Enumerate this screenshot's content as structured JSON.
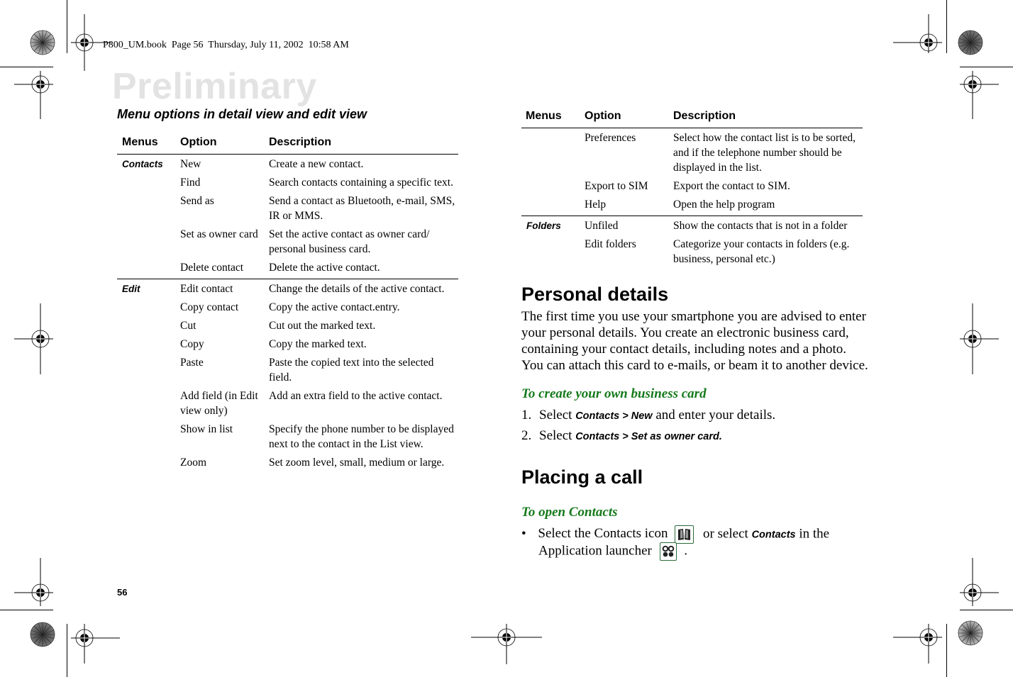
{
  "header": {
    "print_info": "P800_UM.book  Page 56  Thursday, July 11, 2002  10:58 AM",
    "watermark": "Preliminary"
  },
  "left_column": {
    "section_title": "Menu options in detail view and edit view",
    "table": {
      "columns": [
        "Menus",
        "Option",
        "Description"
      ],
      "groups": [
        {
          "menu": "Contacts",
          "rows": [
            {
              "option": "New",
              "description": "Create a new contact."
            },
            {
              "option": "Find",
              "description": "Search contacts containing a specific text."
            },
            {
              "option": "Send as",
              "description": "Send a contact as Bluetooth, e-mail, SMS, IR or MMS."
            },
            {
              "option": "Set as owner card",
              "description": "Set the active contact as owner card/ personal business card."
            },
            {
              "option": "Delete contact",
              "description": "Delete the active contact."
            }
          ]
        },
        {
          "menu": "Edit",
          "rows": [
            {
              "option": "Edit contact",
              "description": "Change the details of the active contact."
            },
            {
              "option": "Copy contact",
              "description": "Copy the active contact.entry."
            },
            {
              "option": "Cut",
              "description": "Cut out the marked text."
            },
            {
              "option": "Copy",
              "description": "Copy the marked text."
            },
            {
              "option": "Paste",
              "description": "Paste the copied text into the selected field."
            },
            {
              "option": "Add field (in Edit view only)",
              "description": "Add an extra field to the active contact."
            },
            {
              "option": "Show in list",
              "description": "Specify the phone number to be displayed next to the contact in the List view."
            },
            {
              "option": "Zoom",
              "description": "Set zoom level, small, medium or large."
            }
          ]
        }
      ]
    }
  },
  "right_column": {
    "table": {
      "columns": [
        "Menus",
        "Option",
        "Description"
      ],
      "groups": [
        {
          "menu": "",
          "rows": [
            {
              "option": "Preferences",
              "description": "Select how the contact list is to be sorted, and if the telephone number should be displayed in the list."
            },
            {
              "option": "Export to SIM",
              "description": "Export the contact to SIM."
            },
            {
              "option": "Help",
              "description": "Open the help program"
            }
          ]
        },
        {
          "menu": "Folders",
          "rows": [
            {
              "option": "Unfiled",
              "description": "Show the contacts that is not in a folder"
            },
            {
              "option": "Edit folders",
              "description": "Categorize your contacts in folders (e.g. business, personal etc.)"
            }
          ]
        }
      ]
    },
    "personal_details": {
      "heading": "Personal details",
      "paragraph": "The first time you use your smartphone you are advised to enter your personal details. You create an electronic business card, containing your contact details, including notes and a photo. You can attach this card to e-mails, or beam it to another device.",
      "subheading": "To create your own business card",
      "steps": [
        {
          "number": "1.",
          "prefix": "Select ",
          "ui": "Contacts > New",
          "suffix": " and enter your details."
        },
        {
          "number": "2.",
          "prefix": "Select ",
          "ui": "Contacts > Set as owner card.",
          "suffix": ""
        }
      ]
    },
    "placing_call": {
      "heading": "Placing a call",
      "subheading": "To open Contacts",
      "bullet": "•",
      "line1_prefix": "Select the Contacts icon",
      "line1_mid": "or select ",
      "line1_ui": "Contacts",
      "line1_suffix": " in the",
      "line2_prefix": "Application launcher",
      "line2_suffix": ".",
      "icons": [
        "contacts-book-icon",
        "app-launcher-icon"
      ]
    }
  },
  "footer": {
    "page_number": "56"
  },
  "colors": {
    "subheading_green": "#157a1b",
    "watermark_gray": "#e3e3e3",
    "icon_border_green": "#2c6b3c"
  }
}
